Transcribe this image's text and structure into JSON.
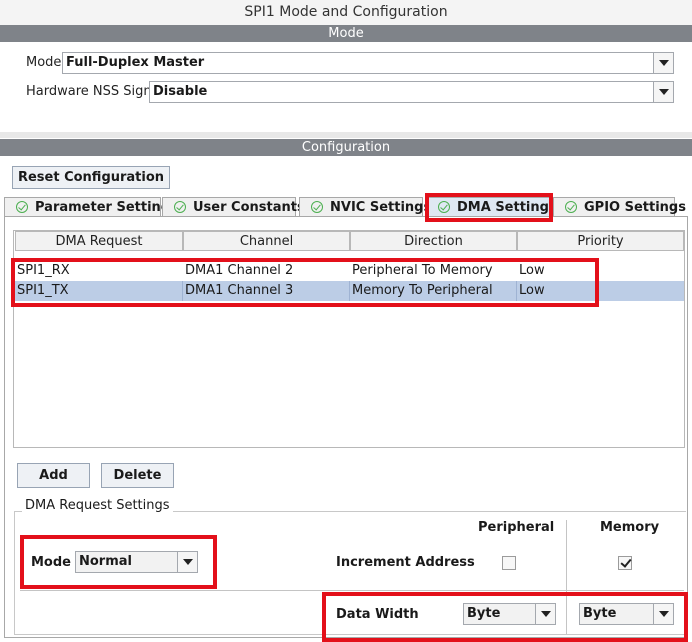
{
  "window": {
    "title": "SPI1 Mode and Configuration"
  },
  "mode_section": {
    "header": "Mode",
    "mode_label": "Mode",
    "mode_value": "Full-Duplex Master",
    "nss_label": "Hardware NSS Signal",
    "nss_value": "Disable"
  },
  "config_section": {
    "header": "Configuration",
    "reset_button": "Reset Configuration",
    "tabs": [
      {
        "label": "Parameter Settings",
        "active": false
      },
      {
        "label": "User Constants",
        "active": false
      },
      {
        "label": "NVIC Settings",
        "active": false
      },
      {
        "label": "DMA Settings",
        "active": true
      },
      {
        "label": "GPIO Settings",
        "active": false
      }
    ]
  },
  "dma_table": {
    "columns": [
      "DMA Request",
      "Channel",
      "Direction",
      "Priority"
    ],
    "rows": [
      {
        "request": "SPI1_RX",
        "channel": "DMA1 Channel 2",
        "direction": "Peripheral To Memory",
        "priority": "Low",
        "selected": false
      },
      {
        "request": "SPI1_TX",
        "channel": "DMA1 Channel 3",
        "direction": "Memory To Peripheral",
        "priority": "Low",
        "selected": true
      }
    ],
    "add_button": "Add",
    "delete_button": "Delete"
  },
  "dma_request_settings": {
    "legend": "DMA Request Settings",
    "peripheral_header": "Peripheral",
    "memory_header": "Memory",
    "mode_label": "Mode",
    "mode_value": "Normal",
    "increment_label": "Increment Address",
    "increment_peripheral": false,
    "increment_memory": true,
    "data_width_label": "Data Width",
    "data_width_peripheral": "Byte",
    "data_width_memory": "Byte"
  },
  "colors": {
    "section_header": "#7f8389",
    "selected_row": "#bccde6",
    "highlight_box": "#e3101a",
    "check_green": "#4caf50"
  }
}
